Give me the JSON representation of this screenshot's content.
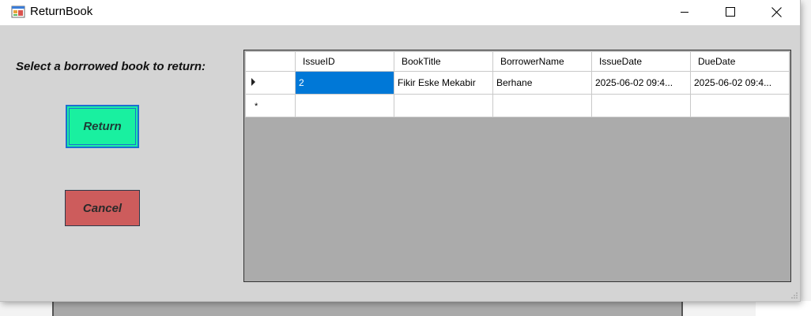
{
  "window": {
    "title": "ReturnBook",
    "controls": {
      "minimize": "minimize",
      "maximize": "maximize",
      "close": "close"
    }
  },
  "prompt_label": "Select a borrowed book to return:",
  "buttons": {
    "return_label": "Return",
    "cancel_label": "Cancel"
  },
  "grid": {
    "columns": [
      "IssueID",
      "BookTitle",
      "BorrowerName",
      "IssueDate",
      "DueDate"
    ],
    "rows": [
      {
        "issue_id": "2",
        "book_title": "Fikir Eske Mekabir",
        "borrower_name": "Berhane",
        "issue_date": "2025-06-02 09:4...",
        "due_date": "2025-06-02 09:4..."
      }
    ],
    "new_row_marker": "*"
  },
  "colors": {
    "return_button": "#19f0a0",
    "cancel_button": "#cd5c5c",
    "selection": "#0078d7",
    "grid_background": "#ababab",
    "form_background": "#d4d4d4"
  }
}
